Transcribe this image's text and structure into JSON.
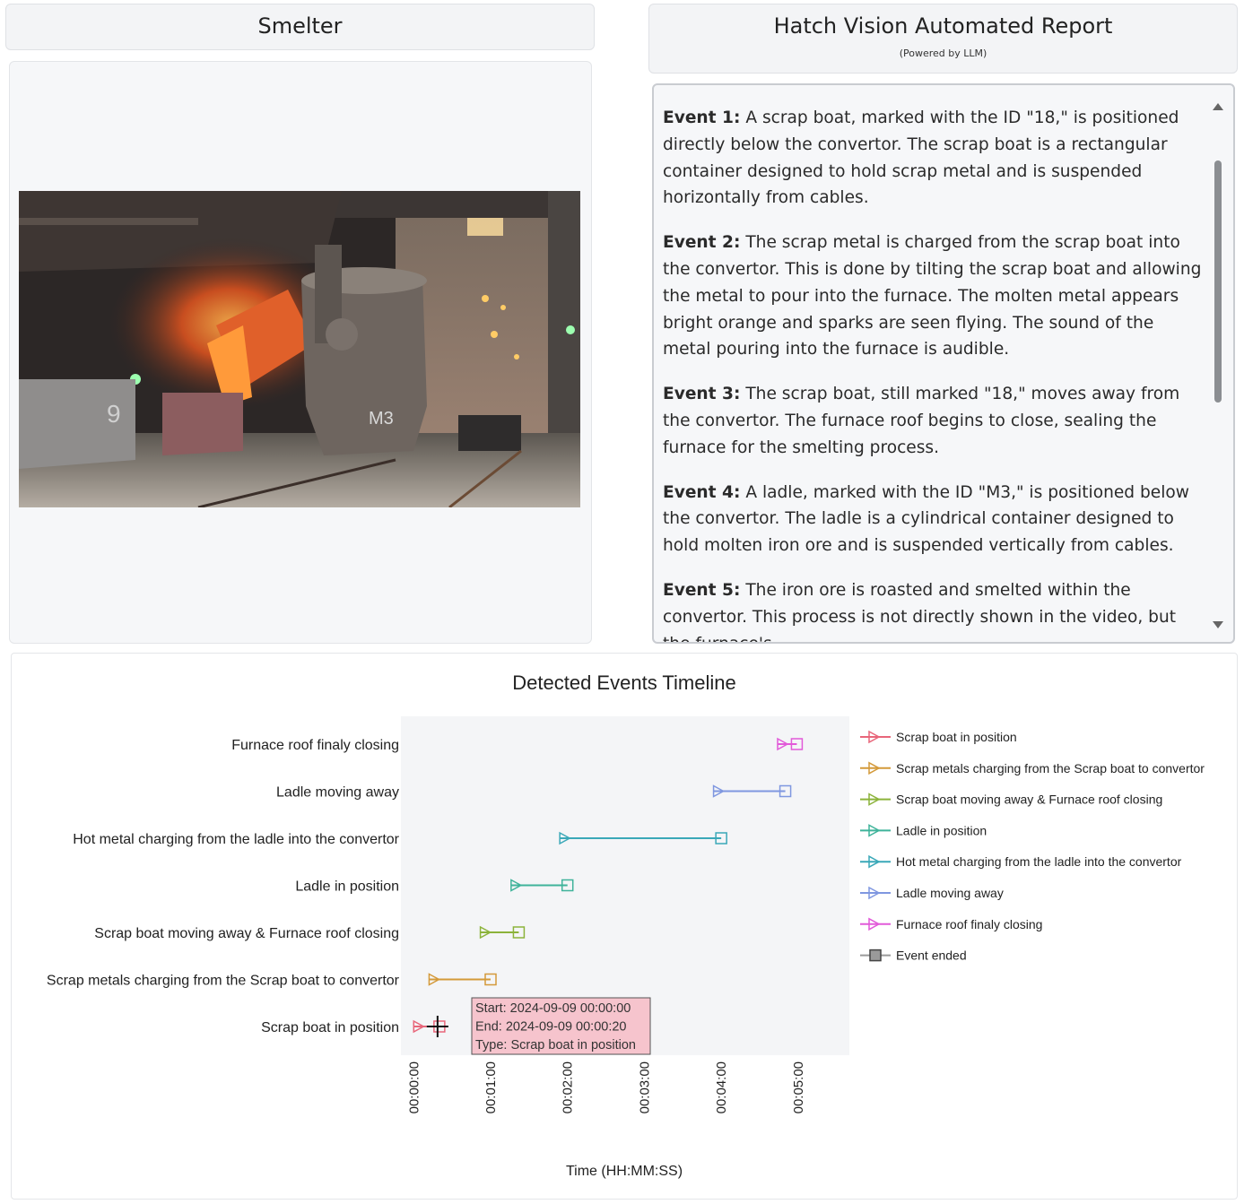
{
  "smelter_header": {
    "title": "Smelter"
  },
  "report_header": {
    "title": "Hatch Vision Automated Report",
    "subtitle": "(Powered by LLM)"
  },
  "video": {
    "ladle_label": "M3",
    "boat_label": "9"
  },
  "report": {
    "events": [
      {
        "label": "Event 1:",
        "text": " A scrap boat, marked with the ID \"18,\" is positioned directly below the convertor. The scrap boat is a rectangular container designed to hold scrap metal and is suspended horizontally from cables."
      },
      {
        "label": "Event 2:",
        "text": " The scrap metal is charged from the scrap boat into the convertor. This is done by tilting the scrap boat and allowing the metal to pour into the furnace. The molten metal appears bright orange and sparks are seen flying. The sound of the metal pouring into the furnace is audible."
      },
      {
        "label": "Event 3:",
        "text": " The scrap boat, still marked \"18,\" moves away from the convertor. The furnace roof begins to close, sealing the furnace for the smelting process."
      },
      {
        "label": "Event 4:",
        "text": " A ladle, marked with the ID \"M3,\" is positioned below the convertor. The ladle is a cylindrical container designed to hold molten iron ore and is suspended vertically from cables."
      },
      {
        "label": "Event 5:",
        "text": " The iron ore is roasted and smelted within the convertor. This process is not directly shown in the video, but the furnace's"
      }
    ]
  },
  "chart_data": {
    "type": "timeline",
    "title": "Detected Events Timeline",
    "xlabel": "Time (HH:MM:SS)",
    "xlim_seconds": [
      -10,
      340
    ],
    "x_ticks": [
      "00:00:00",
      "00:01:00",
      "00:02:00",
      "00:03:00",
      "00:04:00",
      "00:05:00"
    ],
    "x_tick_seconds": [
      0,
      60,
      120,
      180,
      240,
      300
    ],
    "events": [
      {
        "name": "Scrap boat in position",
        "start_s": 0,
        "end_s": 20,
        "color": "#e8667a"
      },
      {
        "name": "Scrap metals charging from the Scrap boat to convertor",
        "start_s": 12,
        "end_s": 60,
        "color": "#d49a3a"
      },
      {
        "name": "Scrap boat moving away & Furnace roof closing",
        "start_s": 52,
        "end_s": 82,
        "color": "#8cb33b"
      },
      {
        "name": "Ladle in position",
        "start_s": 76,
        "end_s": 120,
        "color": "#3fb39a"
      },
      {
        "name": "Hot metal charging from the ladle into the convertor",
        "start_s": 114,
        "end_s": 240,
        "color": "#3aa8b8"
      },
      {
        "name": "Ladle moving away",
        "start_s": 234,
        "end_s": 290,
        "color": "#7f97e0"
      },
      {
        "name": "Furnace roof finaly closing",
        "start_s": 284,
        "end_s": 299,
        "color": "#e25ad9"
      }
    ],
    "legend": {
      "placement": "right",
      "ended_label": "Event ended"
    },
    "tooltip": {
      "lines": [
        "Start: 2024-09-09 00:00:00",
        "End: 2024-09-09 00:00:20",
        "Type: Scrap boat in position"
      ]
    }
  }
}
